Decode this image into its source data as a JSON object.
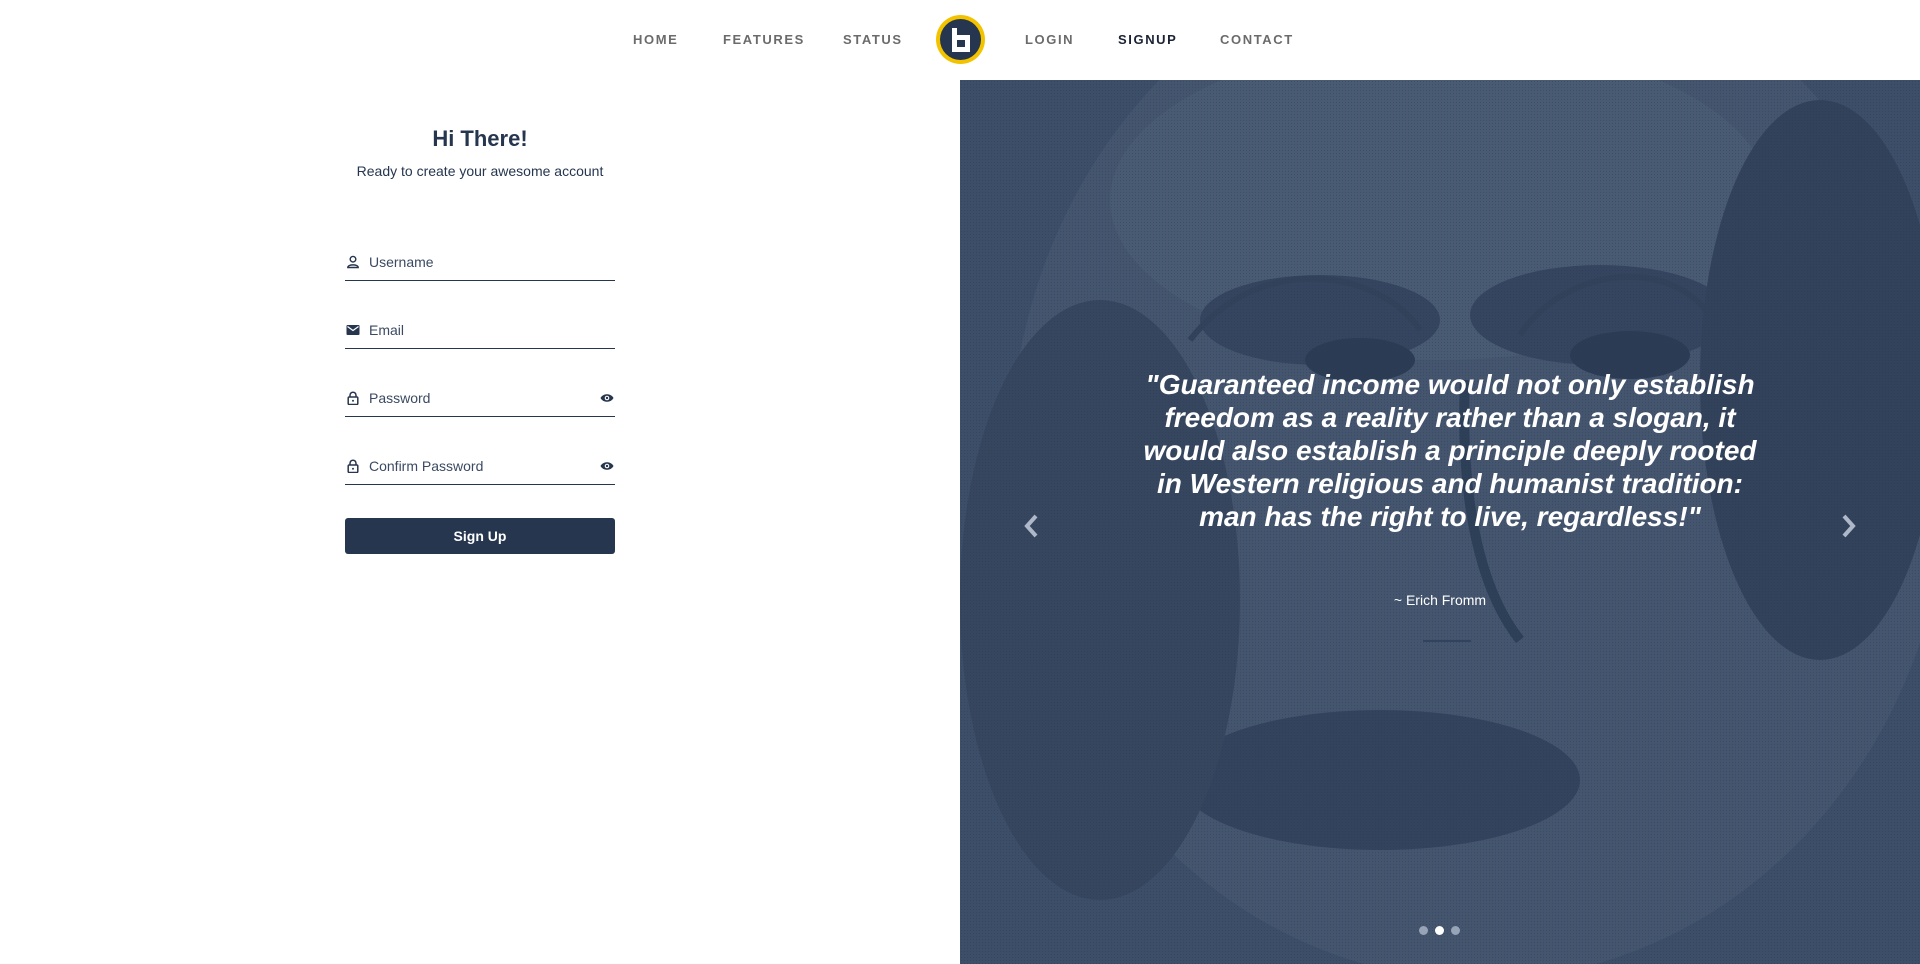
{
  "nav": {
    "items": [
      {
        "label": "HOME"
      },
      {
        "label": "FEATURES"
      },
      {
        "label": "STATUS"
      },
      {
        "label": "LOGIN"
      },
      {
        "label": "SIGNUP",
        "active": true
      },
      {
        "label": "CONTACT"
      }
    ],
    "logo_icon": "b-logo-icon"
  },
  "form": {
    "title": "Hi There!",
    "subtitle": "Ready to create your awesome account",
    "username": {
      "placeholder": "Username",
      "icon": "user-icon"
    },
    "email": {
      "placeholder": "Email",
      "icon": "envelope-icon"
    },
    "password": {
      "placeholder": "Password",
      "icon": "lock-icon",
      "toggle_icon": "eye-icon"
    },
    "confirm_password": {
      "placeholder": "Confirm Password",
      "icon": "lock-icon",
      "toggle_icon": "eye-icon"
    },
    "submit_label": "Sign Up"
  },
  "carousel": {
    "quote": "\"Guaranteed income would not only establish freedom as a reality rather than a slogan, it would also establish a principle deeply rooted in Western religious and humanist tradition: man has the right to live, regardless!\"",
    "author": "~ Erich Fromm",
    "slides": 3,
    "active_slide": 2
  },
  "colors": {
    "primary": "#26364f",
    "logo_ring": "#f3c300",
    "overlay": "#4a5a74",
    "white": "#ffffff"
  }
}
